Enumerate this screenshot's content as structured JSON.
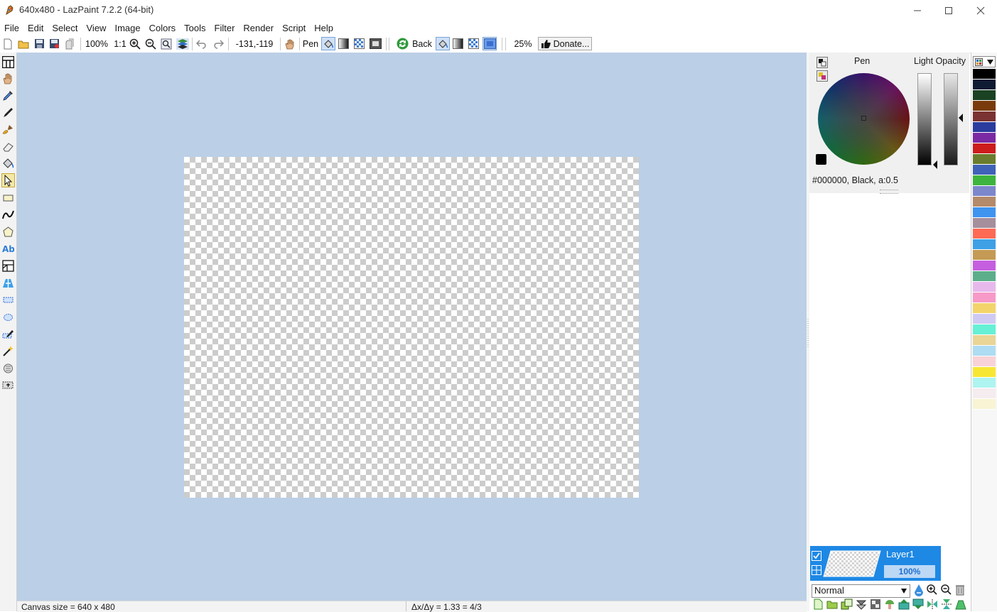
{
  "window": {
    "title": "640x480 - LazPaint 7.2.2 (64-bit)",
    "minimize": "—",
    "maximize": "☐",
    "close": "✕"
  },
  "menu": [
    "File",
    "Edit",
    "Select",
    "View",
    "Image",
    "Colors",
    "Tools",
    "Filter",
    "Render",
    "Script",
    "Help"
  ],
  "toolbar": {
    "zoom_value": "100%",
    "zoom_original": "1:1",
    "cursor_position": "-131,-119",
    "pen_label": "Pen",
    "back_label": "Back",
    "opacity_value": "25%",
    "donate_label": "Donate..."
  },
  "status": {
    "canvas_size": "Canvas size = 640 x 480",
    "ratio": "Δx/Δy = 1.33 = 4/3"
  },
  "color_panel": {
    "pen_label": "Pen",
    "light_opacity_label": "Light Opacity",
    "color_info": "#000000, Black, a:0.5"
  },
  "layers": {
    "layer_name": "Layer1",
    "layer_opacity": "100%",
    "blend_mode": "Normal"
  },
  "palette_colors": [
    "#000000",
    "#0f1a33",
    "#1b4223",
    "#7a3b0c",
    "#7a3232",
    "#2b3c9e",
    "#7b2aa3",
    "#cc1c1c",
    "#6a7d2e",
    "#3f62b8",
    "#3db43d",
    "#7d88cc",
    "#b58a6a",
    "#3f94f0",
    "#a58f9d",
    "#ff6a55",
    "#3fa0e6",
    "#c49a55",
    "#c55fe0",
    "#5cae8a",
    "#e7b8ec",
    "#f79ac8",
    "#f2d46b",
    "#cfcaf3",
    "#66f0d6",
    "#ead496",
    "#aedcf2",
    "#f8d2d6",
    "#f8e634",
    "#aef4f0",
    "#f4ecef",
    "#f8f4d4"
  ]
}
